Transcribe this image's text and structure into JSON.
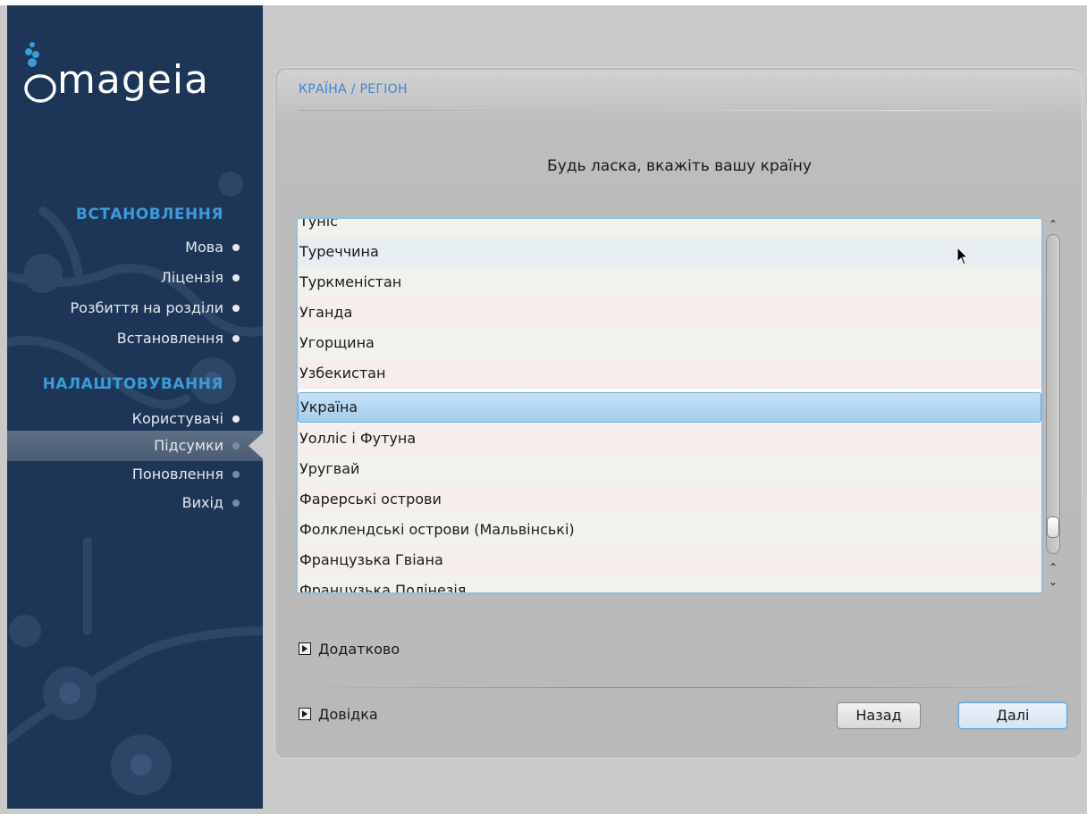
{
  "sidebar": {
    "brand": "mageia",
    "sections": [
      {
        "title": "ВСТАНОВЛЕННЯ",
        "items": [
          "Мова",
          "Ліцензія",
          "Розбиття на розділи",
          "Встановлення"
        ]
      },
      {
        "title": "НАЛАШТОВУВАННЯ",
        "items": [
          "Користувачі",
          "Підсумки",
          "Поновлення",
          "Вихід"
        ]
      }
    ],
    "active_item": "Підсумки"
  },
  "header": {
    "title": "КРАЇНА / РЕГІОН"
  },
  "main": {
    "prompt": "Будь ласка, вкажіть вашу країну",
    "countries": [
      "Туніс",
      "Туреччина",
      "Туркменістан",
      "Уганда",
      "Угорщина",
      "Узбекистан",
      "Україна",
      "Уолліс і Футуна",
      "Уругвай",
      "Фарерські острови",
      "Фолклендські острови (Мальвінські)",
      "Французька Гвіана",
      "Французька Полінезія"
    ],
    "selected_country": "Україна",
    "hovered_country": "Туреччина",
    "advanced_label": "Додатково",
    "help_label": "Довідка"
  },
  "buttons": {
    "back": "Назад",
    "next": "Далі"
  },
  "colors": {
    "sidebar_bg": "#1d3658",
    "section_title": "#3b9bd8",
    "header_title": "#3b86d8",
    "selection": "#a5cdee"
  }
}
